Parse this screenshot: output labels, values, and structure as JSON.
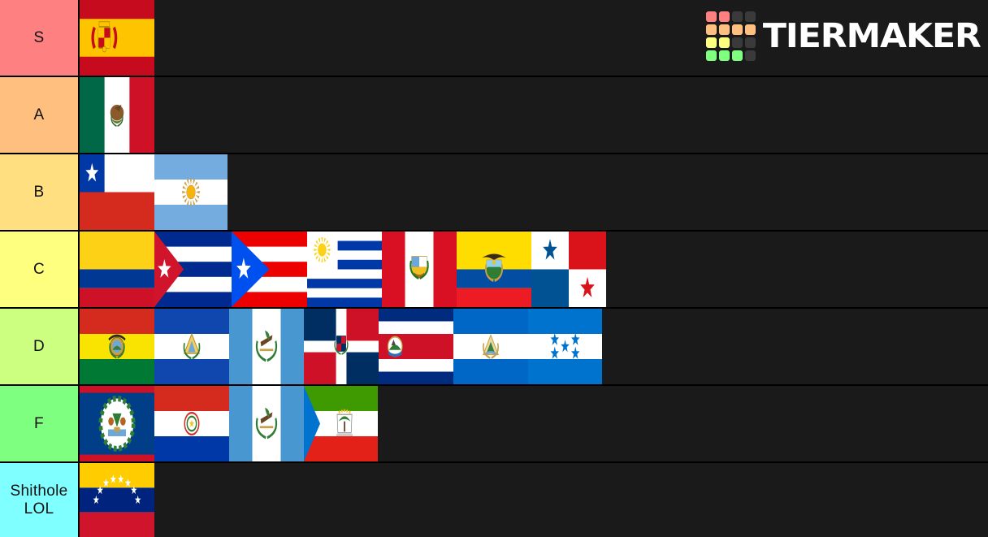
{
  "app": {
    "name": "TierMaker",
    "watermark_text": "TIERMAKER",
    "background_color": "#1a1a1a",
    "grid_colors": [
      [
        "#ff8080",
        "#ff8080",
        "#3a3a3a",
        "#3a3a3a"
      ],
      [
        "#ffbf7f",
        "#ffbf7f",
        "#ffbf7f",
        "#ffbf7f"
      ],
      [
        "#ffff7f",
        "#ffff7f",
        "#3a3a3a",
        "#3a3a3a"
      ],
      [
        "#7fff7f",
        "#7fff7f",
        "#7fff7f",
        "#3a3a3a"
      ]
    ]
  },
  "tiers": [
    {
      "label": "S",
      "color": "#ff8080",
      "items": [
        {
          "name": "Spain",
          "flag": "spain",
          "width": 92
        }
      ]
    },
    {
      "label": "A",
      "color": "#ffbf7f",
      "items": [
        {
          "name": "Mexico",
          "flag": "mexico",
          "width": 92
        }
      ]
    },
    {
      "label": "B",
      "color": "#ffdf80",
      "items": [
        {
          "name": "Chile",
          "flag": "chile",
          "width": 92
        },
        {
          "name": "Argentina",
          "flag": "argentina",
          "width": 90
        }
      ]
    },
    {
      "label": "C",
      "color": "#ffff7f",
      "items": [
        {
          "name": "Colombia",
          "flag": "colombia",
          "width": 92
        },
        {
          "name": "Cuba",
          "flag": "cuba",
          "width": 95
        },
        {
          "name": "Puerto Rico",
          "flag": "puerto-rico",
          "width": 93
        },
        {
          "name": "Uruguay",
          "flag": "uruguay",
          "width": 92
        },
        {
          "name": "Peru",
          "flag": "peru",
          "width": 92
        },
        {
          "name": "Ecuador",
          "flag": "ecuador",
          "width": 92
        },
        {
          "name": "Panama",
          "flag": "panama",
          "width": 92
        }
      ]
    },
    {
      "label": "D",
      "color": "#ccff80",
      "items": [
        {
          "name": "Bolivia",
          "flag": "bolivia",
          "width": 92
        },
        {
          "name": "El Salvador",
          "flag": "el-salvador",
          "width": 92
        },
        {
          "name": "Guatemala",
          "flag": "guatemala",
          "width": 92
        },
        {
          "name": "Dominican Republic",
          "flag": "dominican-republic",
          "width": 92
        },
        {
          "name": "Costa Rica",
          "flag": "costa-rica",
          "width": 92
        },
        {
          "name": "Nicaragua",
          "flag": "nicaragua",
          "width": 92
        },
        {
          "name": "Honduras",
          "flag": "honduras",
          "width": 91
        }
      ]
    },
    {
      "label": "F",
      "color": "#7fff7f",
      "items": [
        {
          "name": "Belize",
          "flag": "belize",
          "width": 92
        },
        {
          "name": "Paraguay",
          "flag": "paraguay",
          "width": 92
        },
        {
          "name": "Guatemala",
          "flag": "guatemala",
          "width": 92
        },
        {
          "name": "Equatorial Guinea",
          "flag": "equatorial-guinea",
          "width": 91
        }
      ]
    },
    {
      "label": "Shithole LOL",
      "color": "#7fffff",
      "items": [
        {
          "name": "Venezuela",
          "flag": "venezuela",
          "width": 92
        }
      ]
    }
  ]
}
